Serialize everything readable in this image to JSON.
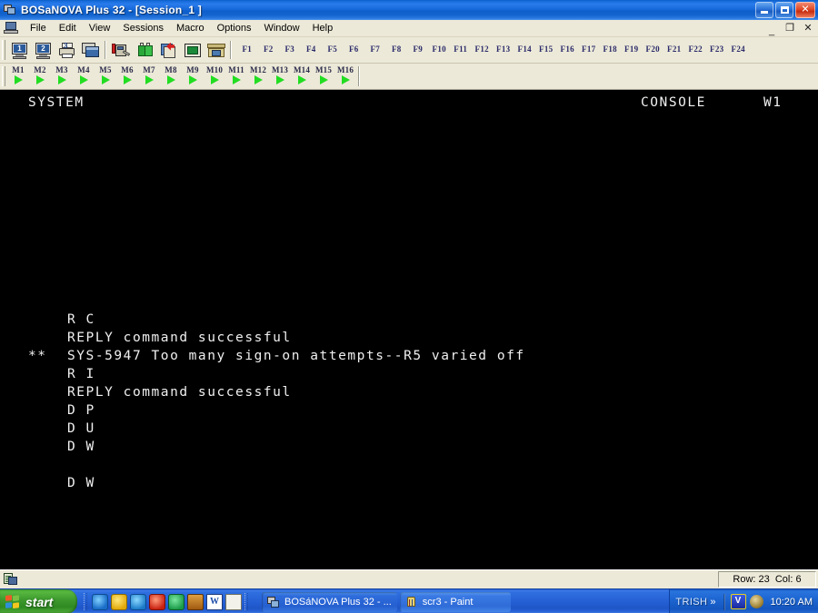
{
  "window": {
    "title": "BOSaNOVA Plus 32 - [Session_1 ]",
    "app_icon": "terminal-session-icon",
    "buttons": {
      "minimize": "_",
      "maximize": "□",
      "close": "✕"
    }
  },
  "menubar": {
    "doc_icon": "mdi-document-icon",
    "items": [
      {
        "label": "File"
      },
      {
        "label": "Edit"
      },
      {
        "label": "View"
      },
      {
        "label": "Sessions"
      },
      {
        "label": "Macro"
      },
      {
        "label": "Options"
      },
      {
        "label": "Window"
      },
      {
        "label": "Help"
      }
    ],
    "mdi_buttons": {
      "minimize": "_",
      "restore": "❐",
      "close": "✕"
    }
  },
  "toolbar": {
    "buttons": [
      {
        "name": "session-1-button",
        "icon": "monitor-1-icon",
        "label": "1"
      },
      {
        "name": "session-2-button",
        "icon": "monitor-2-icon",
        "label": "2"
      },
      {
        "name": "printer-session-3-button",
        "icon": "printer-3-icon",
        "label": "3"
      },
      {
        "name": "display-session-button",
        "icon": "windows-cascade-icon",
        "label": ""
      },
      {
        "name": "config-red-button",
        "icon": "red-config-tool-icon",
        "label": ""
      },
      {
        "name": "config-green-button",
        "icon": "green-config-tool-icon",
        "label": ""
      },
      {
        "name": "keyboard-remap-button",
        "icon": "keyboard-remap-icon",
        "label": ""
      },
      {
        "name": "screen-capture-button",
        "icon": "green-screen-icon",
        "label": ""
      },
      {
        "name": "file-transfer-button",
        "icon": "file-transfer-icon",
        "label": ""
      }
    ]
  },
  "fkeys": {
    "items": [
      "F1",
      "F2",
      "F3",
      "F4",
      "F5",
      "F6",
      "F7",
      "F8",
      "F9",
      "F10",
      "F11",
      "F12",
      "F13",
      "F14",
      "F15",
      "F16",
      "F17",
      "F18",
      "F19",
      "F20",
      "F21",
      "F22",
      "F23",
      "F24"
    ]
  },
  "macrokeys": {
    "items": [
      "M1",
      "M2",
      "M3",
      "M4",
      "M5",
      "M6",
      "M7",
      "M8",
      "M9",
      "M10",
      "M11",
      "M12",
      "M13",
      "M14",
      "M15",
      "M16"
    ],
    "arrow_icon": "play-triangle-icon",
    "arrow_color": "#22dd22"
  },
  "terminal": {
    "background": "#000000",
    "foreground": "#f0f0f0",
    "header": {
      "left": "SYSTEM",
      "center": "CONSOLE",
      "right": "W1"
    },
    "lines": [
      {
        "marker": "",
        "text": "R C"
      },
      {
        "marker": "",
        "text": "REPLY command successful"
      },
      {
        "marker": "**",
        "text": "SYS-5947 Too many sign-on attempts--R5 varied off"
      },
      {
        "marker": "",
        "text": "R I"
      },
      {
        "marker": "",
        "text": "REPLY command successful"
      },
      {
        "marker": "",
        "text": "D P"
      },
      {
        "marker": "",
        "text": "D U"
      },
      {
        "marker": "",
        "text": "D W"
      },
      {
        "marker": "",
        "text": ""
      },
      {
        "marker": "",
        "text": "D W"
      }
    ],
    "cursor": {
      "visible": true,
      "row": 23,
      "col": 6
    }
  },
  "statusbar": {
    "icon": "session-status-icon",
    "position": "Row: 23  Col: 6"
  },
  "taskbar": {
    "start_label": "start",
    "start_icon": "windows-flag-icon",
    "quicklaunch": [
      {
        "name": "internet-explorer-icon",
        "color": "#1a6ec8"
      },
      {
        "name": "messenger-icon",
        "color": "#e8c018"
      },
      {
        "name": "outlook-express-icon",
        "color": "#1a8ad8"
      },
      {
        "name": "media-player-icon",
        "color": "#d83020"
      },
      {
        "name": "network-globe-icon",
        "color": "#1a9a48"
      },
      {
        "name": "desktop-icon",
        "color": "#b05a18"
      },
      {
        "name": "word-icon",
        "color": "#1a4aa8"
      },
      {
        "name": "notepad-icon",
        "color": "#d8d8d0"
      }
    ],
    "tasks": [
      {
        "name": "task-bosanova",
        "label": "BOSáNOVA Plus 32 - ...",
        "icon": "terminal-session-icon",
        "active": true
      },
      {
        "name": "task-paint",
        "label": "scr3 - Paint",
        "icon": "paint-icon",
        "active": false
      }
    ],
    "tray": {
      "user": "TRISH",
      "chevron": "»",
      "icons": [
        {
          "name": "antivirus-shield-icon",
          "color": "#1a3acc"
        },
        {
          "name": "update-icon",
          "color": "#b8860b"
        }
      ],
      "time": "10:20 AM"
    }
  }
}
